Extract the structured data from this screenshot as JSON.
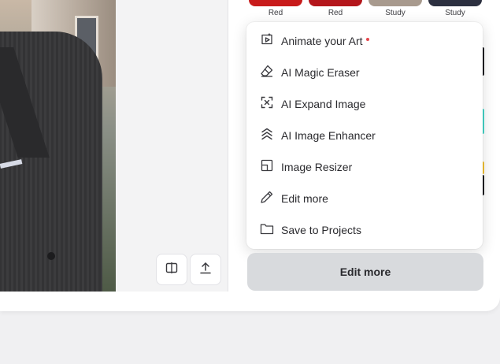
{
  "thumbnails": [
    {
      "label": "Red",
      "color": "#c81b1b"
    },
    {
      "label": "Red",
      "color": "#b4161b"
    },
    {
      "label": "Study",
      "color": "#a89a8e"
    },
    {
      "label": "Study",
      "color": "#2c3040"
    }
  ],
  "canvas_tools": [
    {
      "icon": "compare-split-icon"
    },
    {
      "icon": "upload-icon"
    }
  ],
  "menu": {
    "items": [
      {
        "label": "Animate your Art",
        "icon": "animate-play-icon",
        "new_badge": true
      },
      {
        "label": "AI Magic Eraser",
        "icon": "eraser-icon"
      },
      {
        "label": "AI Expand Image",
        "icon": "expand-icon"
      },
      {
        "label": "AI Image Enhancer",
        "icon": "enhance-chevrons-icon"
      },
      {
        "label": "Image Resizer",
        "icon": "resize-icon"
      },
      {
        "label": "Edit more",
        "icon": "pencil-icon"
      },
      {
        "label": "Save to Projects",
        "icon": "folder-icon"
      }
    ]
  },
  "edit_more_button": {
    "label": "Edit more"
  },
  "colors": {
    "accent_teal": "#45d6c9",
    "accent_yellow": "#f3c232",
    "badge_red": "#e5484d"
  }
}
